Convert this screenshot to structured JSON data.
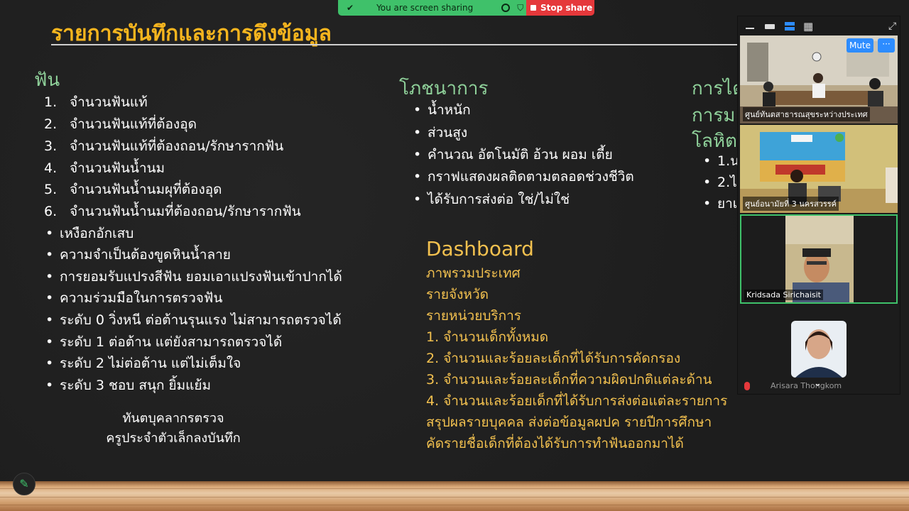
{
  "share_bar": {
    "sharing_label": "You are screen sharing",
    "stop_label": "Stop share",
    "colors": {
      "green": "#3fc16a",
      "red": "#e5383b"
    }
  },
  "slide": {
    "title": "รายการบันทึกและการดึงข้อมูล",
    "teeth": {
      "heading": "ฟัน",
      "numbered": [
        {
          "num": "1.",
          "text": "จำนวนฟันแท้"
        },
        {
          "num": "2.",
          "text": "จำนวนฟันแท้ที่ต้องอุด"
        },
        {
          "num": "3.",
          "text": "จำนวนฟันแท้ที่ต้องถอน/รักษารากฟัน"
        },
        {
          "num": "4.",
          "text": "จำนวนฟันน้ำนม"
        },
        {
          "num": "5.",
          "text": "จำนวนฟันน้ำนมผุที่ต้องอุด"
        },
        {
          "num": "6.",
          "text": "จำนวนฟันน้ำนมที่ต้องถอน/รักษารากฟัน"
        }
      ],
      "bullets": [
        "เหงือกอักเสบ",
        "ความจำเป็นต้องขูดหินน้ำลาย",
        "การยอมรับแปรงสีฟัน ยอมเอาแปรงฟันเข้าปากได้",
        "ความร่วมมือในการตรวจฟัน",
        "ระดับ 0 วิ่งหนี ต่อต้านรุนแรง ไม่สามารถตรวจได้",
        "ระดับ 1 ต่อต้าน แต่ยังสามารถตรวจได้",
        "ระดับ 2 ไม่ต่อต้าน แต่ไม่เต็มใจ",
        "ระดับ 3 ชอบ สนุก ยิ้มแย้ม"
      ],
      "footer_line1": "ทันตบุคลากรตรวจ",
      "footer_line2": "ครูประจำตัวเล็กลงบันทึก"
    },
    "nutrition": {
      "heading": "โภชนาการ",
      "bullets": [
        "น้ำหนัก",
        "ส่วนสูง",
        "คำนวณ อัตโนมัติ อ้วน ผอม เตี้ย",
        "กราฟแสดงผลติดตามตลอดช่วงชีวิต",
        "ได้รับการส่งต่อ ใช่/ไม่ใช่"
      ]
    },
    "dashboard": {
      "heading": "Dashboard",
      "lines": [
        "ภาพรวมประเทศ",
        "รายจังหวัด",
        "รายหน่วยบริการ",
        "1. จำนวนเด็กทั้งหมด",
        "2. จำนวนและร้อยละเด็กที่ได้รับการคัดกรอง",
        "3. จำนวนและร้อยละเด็กที่ความผิดปกติแต่ละด้าน",
        "4. จำนวนและร้อยเด็กที่ได้รับการส่งต่อแต่ละรายการ",
        "สรุปผลรายบุคคล ส่งต่อข้อมูลผปค รายปีการศึกษา",
        "คัดรายชื่อเด็กที่ต้องได้รับการทำฟันออกมาได้"
      ]
    },
    "partial_col": {
      "lines": [
        "การได",
        "การม",
        "โลหิต"
      ],
      "bullets": [
        "1.น",
        "2.ไ",
        "ยาเ"
      ]
    }
  },
  "panel": {
    "mute_label": "Mute",
    "more_label": "···",
    "participants": [
      {
        "name": "ศูนย์ทันตสาธารณสุขระหว่างประเทศ"
      },
      {
        "name": "ศูนย์อนามัยที่ 3 นครสวรรค์"
      },
      {
        "name": "Kridsada Sirichaisit"
      },
      {
        "name": "Arisara Thongkom"
      }
    ],
    "active_color": "#3fc16a"
  }
}
